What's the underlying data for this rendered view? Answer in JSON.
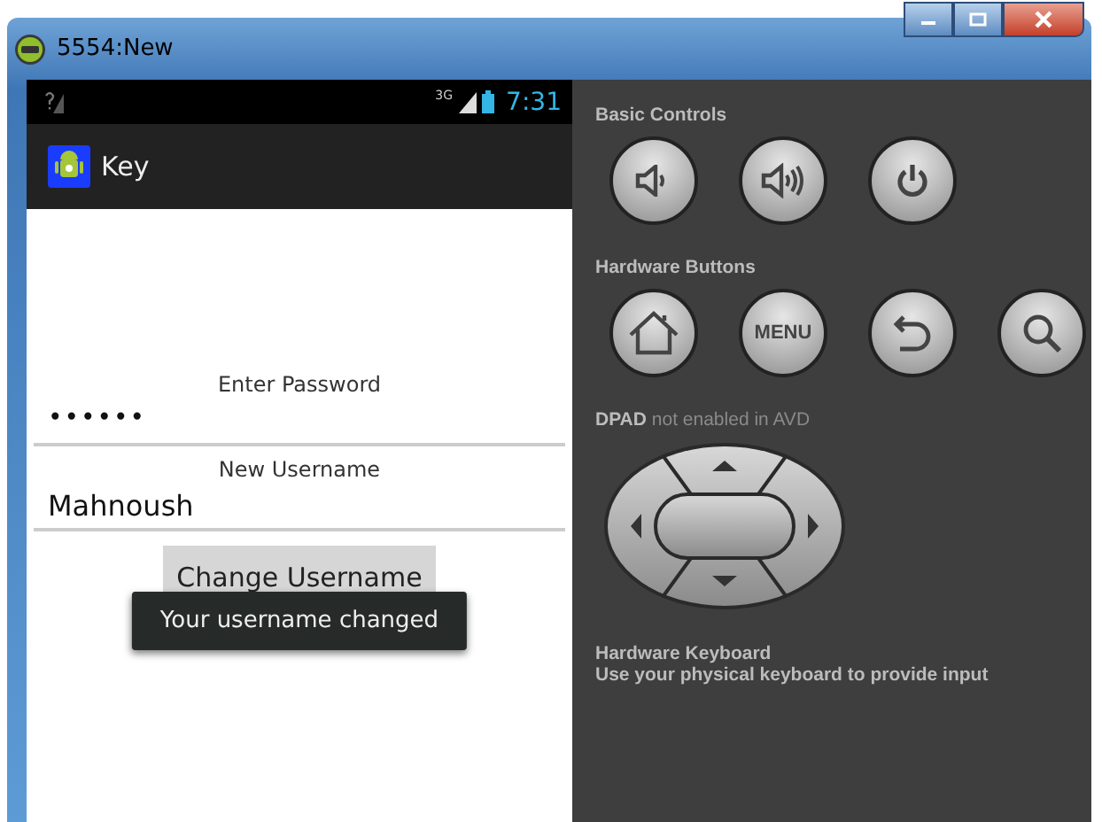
{
  "window": {
    "title": "5554:New"
  },
  "status_bar": {
    "network_label": "3G",
    "time": "7:31"
  },
  "action_bar": {
    "title": "Key"
  },
  "form": {
    "password": {
      "label": "Enter Password",
      "value": "••••••"
    },
    "username": {
      "label": "New Username",
      "value": "Mahnoush"
    },
    "button": "Change Username"
  },
  "toast": "Your username changed",
  "controls": {
    "sections": [
      {
        "kind": "buttons",
        "title": "Basic Controls",
        "buttons": [
          {
            "kind": "volume_down"
          },
          {
            "kind": "volume_up"
          },
          {
            "kind": "power"
          }
        ]
      },
      {
        "kind": "buttons",
        "title": "Hardware Buttons",
        "buttons": [
          {
            "kind": "home"
          },
          {
            "kind": "text",
            "label": "MENU"
          },
          {
            "kind": "back"
          },
          {
            "kind": "search"
          }
        ]
      },
      {
        "kind": "dpad",
        "title": "**DPAD** not enabled in AVD"
      },
      {
        "kind": "keyboard",
        "title": "Hardware Keyboard",
        "description": "Use your physical keyboard to provide input"
      }
    ]
  }
}
